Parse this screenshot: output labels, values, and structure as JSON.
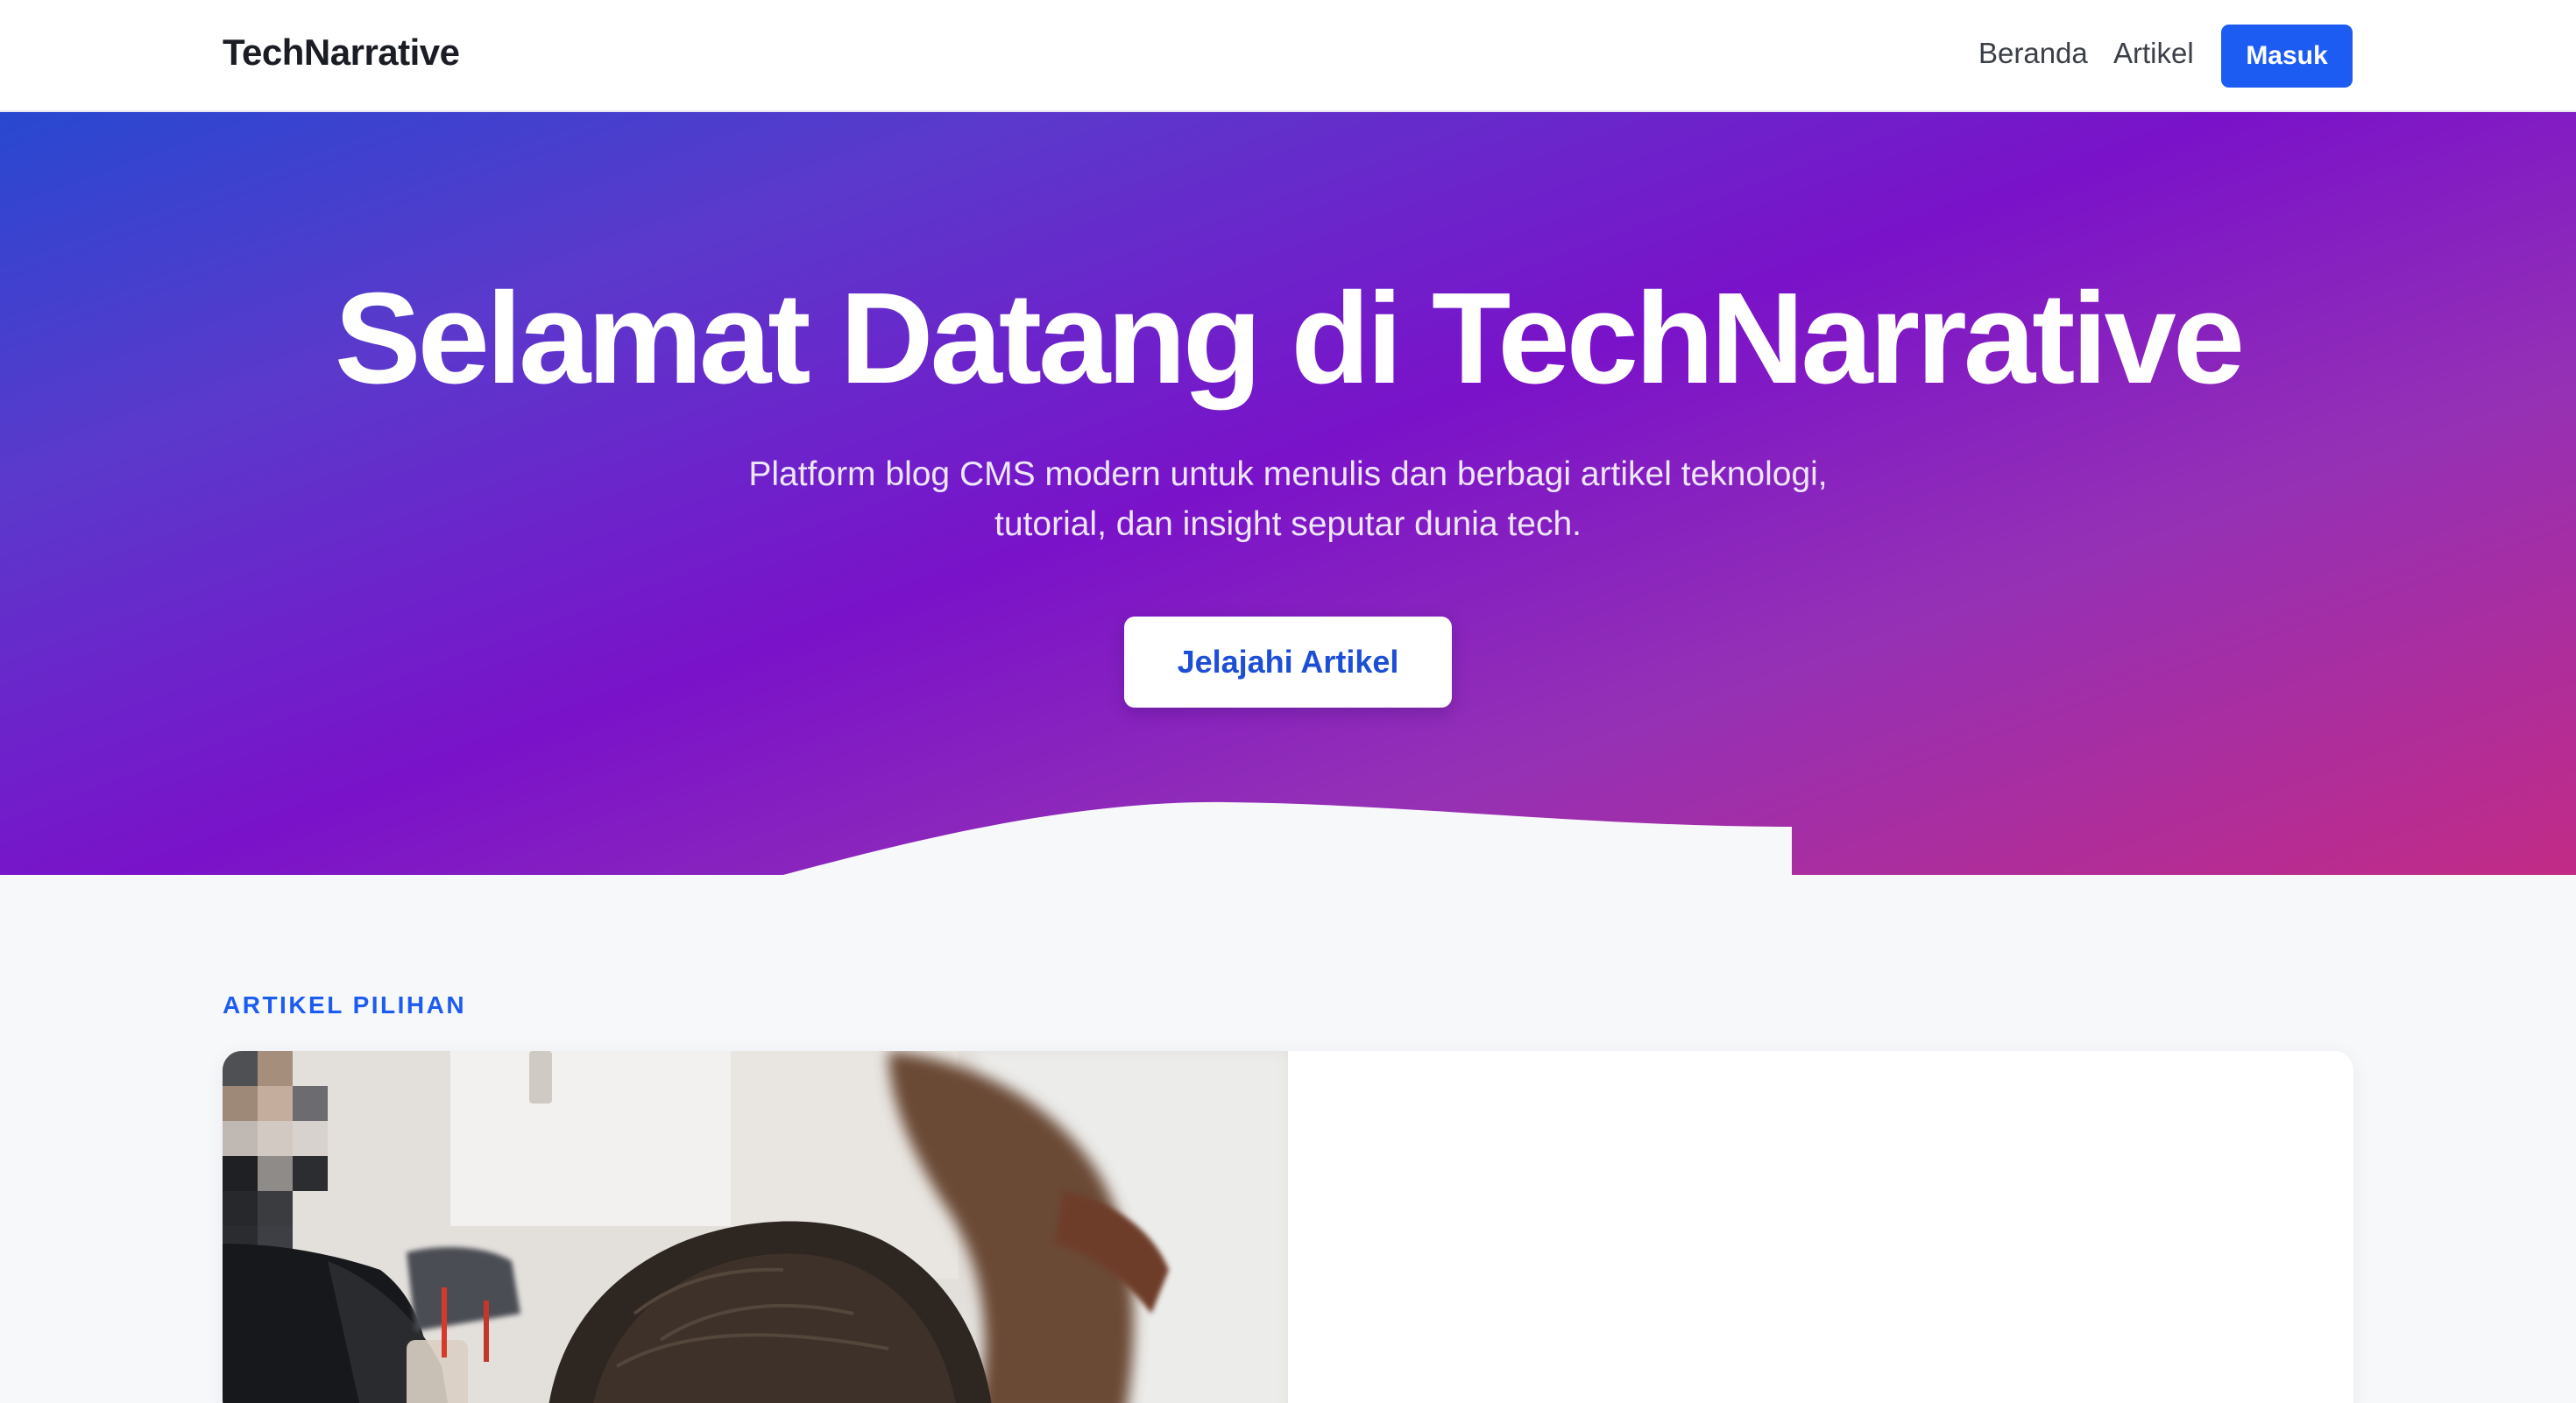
{
  "navbar": {
    "brand": "TechNarrative",
    "links": [
      "Beranda",
      "Artikel"
    ],
    "login_label": "Masuk"
  },
  "hero": {
    "title": "Selamat Datang di TechNarrative",
    "subtitle_line1": "Platform blog CMS modern untuk menulis dan berbagi artikel teknologi,",
    "subtitle_line2": "tutorial, dan insight seputar dunia tech.",
    "cta_label": "Jelajahi Artikel"
  },
  "featured": {
    "section_label": "ARTIKEL PILIHAN"
  },
  "colors": {
    "primary": "#1d5cf2",
    "hero_gradient": [
      "#2848d0",
      "#7a12c9",
      "#c22b86"
    ],
    "background": "#f7f8fa"
  }
}
